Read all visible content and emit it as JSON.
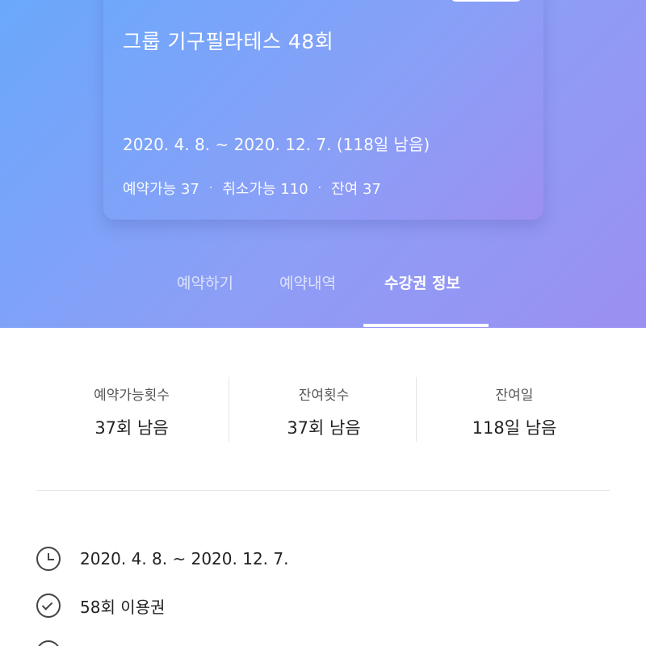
{
  "card": {
    "title": "그룹 기구필라테스 48회",
    "period": "2020. 4. 8. ~ 2020. 12. 7. (118일 남음)",
    "reservable": "예약가능 37",
    "cancelable": "취소가능 110",
    "remaining": "잔여 37",
    "separator": "·"
  },
  "tabs": [
    {
      "label": "예약하기"
    },
    {
      "label": "예약내역"
    },
    {
      "label": "수강권 정보"
    }
  ],
  "stats": [
    {
      "label": "예약가능횟수",
      "value": "37회 남음"
    },
    {
      "label": "잔여횟수",
      "value": "37회 남음"
    },
    {
      "label": "잔여일",
      "value": "118일 남음"
    }
  ],
  "info": {
    "period": "2020. 4. 8. ~ 2020. 12. 7.",
    "usage": "58회 이용권"
  },
  "icons": {
    "period": "clock-icon",
    "usage": "check-circle-icon",
    "next": "check-circle-icon"
  },
  "colors": {
    "gradient_start": "#6aa8fb",
    "gradient_end": "#9b8ff2",
    "text_dark": "#222222"
  }
}
